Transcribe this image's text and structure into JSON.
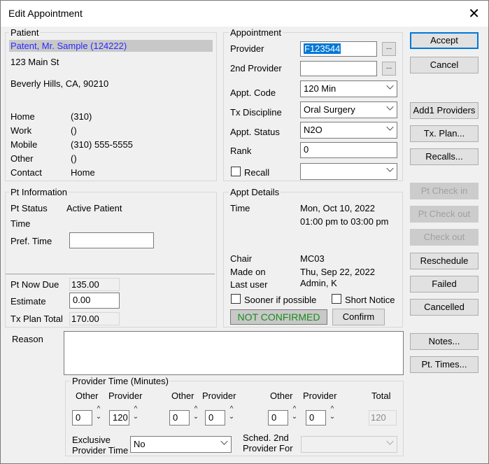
{
  "window": {
    "title": "Edit Appointment"
  },
  "patient": {
    "group_title": "Patient",
    "name": "Patent, Mr. Sample  (124222)",
    "address1": "123 Main St",
    "address2": "Beverly Hills, CA, 90210",
    "phones": [
      {
        "label": "Home",
        "value": "(310)"
      },
      {
        "label": "Work",
        "value": "()"
      },
      {
        "label": "Mobile",
        "value": "(310) 555-5555"
      },
      {
        "label": "Other",
        "value": "()"
      },
      {
        "label": "Contact",
        "value": "Home"
      }
    ]
  },
  "pt_info": {
    "group_title": "Pt Information",
    "status_label": "Pt Status",
    "status_value": "Active Patient",
    "time_label": "Time",
    "pref_time_label": "Pref. Time",
    "pref_time_value": "",
    "now_due_label": "Pt Now Due",
    "now_due_value": "135.00",
    "estimate_label": "Estimate",
    "estimate_value": "0.00",
    "tx_total_label": "Tx Plan Total",
    "tx_total_value": "170.00"
  },
  "appointment": {
    "group_title": "Appointment",
    "provider_label": "Provider",
    "provider_value": "F123544",
    "provider2_label": "2nd Provider",
    "provider2_value": "",
    "appt_code_label": "Appt. Code",
    "appt_code_value": "120 Min",
    "tx_discipline_label": "Tx Discipline",
    "tx_discipline_value": "Oral Surgery",
    "appt_status_label": "Appt. Status",
    "appt_status_value": "N2O",
    "rank_label": "Rank",
    "rank_value": "0",
    "recall_label": "Recall",
    "recall_value": "",
    "ellipsis": "..."
  },
  "appt_details": {
    "group_title": "Appt Details",
    "time_label": "Time",
    "time_date": "Mon, Oct 10, 2022",
    "time_range": "01:00 pm to 03:00 pm",
    "chair_label": "Chair",
    "chair_value": "MC03",
    "made_on_label": "Made on",
    "made_on_value": "Thu, Sep 22, 2022",
    "last_user_label": "Last user",
    "last_user_value": "Admin, K",
    "sooner_label": "Sooner if possible",
    "short_notice_label": "Short Notice",
    "confirm_status": "NOT CONFIRMED",
    "confirm_button": "Confirm",
    "confirm_color": "#1a8a1a"
  },
  "buttons": {
    "accept": "Accept",
    "cancel": "Cancel",
    "add1_providers": "Add1 Providers",
    "tx_plan": "Tx. Plan...",
    "recalls": "Recalls...",
    "pt_check_in": "Pt Check in",
    "pt_check_out": "Pt Check out",
    "check_out": "Check out",
    "reschedule": "Reschedule",
    "failed": "Failed",
    "cancelled": "Cancelled",
    "notes": "Notes...",
    "pt_times": "Pt. Times..."
  },
  "reason": {
    "label": "Reason",
    "value": ""
  },
  "provider_time": {
    "group_title": "Provider Time (Minutes)",
    "other_label": "Other",
    "provider_label": "Provider",
    "total_label": "Total",
    "pairs": [
      {
        "other": "0",
        "provider": "120"
      },
      {
        "other": "0",
        "provider": "0"
      },
      {
        "other": "0",
        "provider": "0"
      }
    ],
    "total_value": "120",
    "exclusive_label1": "Exclusive",
    "exclusive_label2": "Provider Time",
    "exclusive_value": "No",
    "sched_label1": "Sched. 2nd",
    "sched_label2": "Provider For",
    "sched_value": ""
  },
  "colors": {
    "accent": "#0078d7",
    "selected_row_bg": "#c8c8c8",
    "patient_name": "#2a2aff"
  }
}
